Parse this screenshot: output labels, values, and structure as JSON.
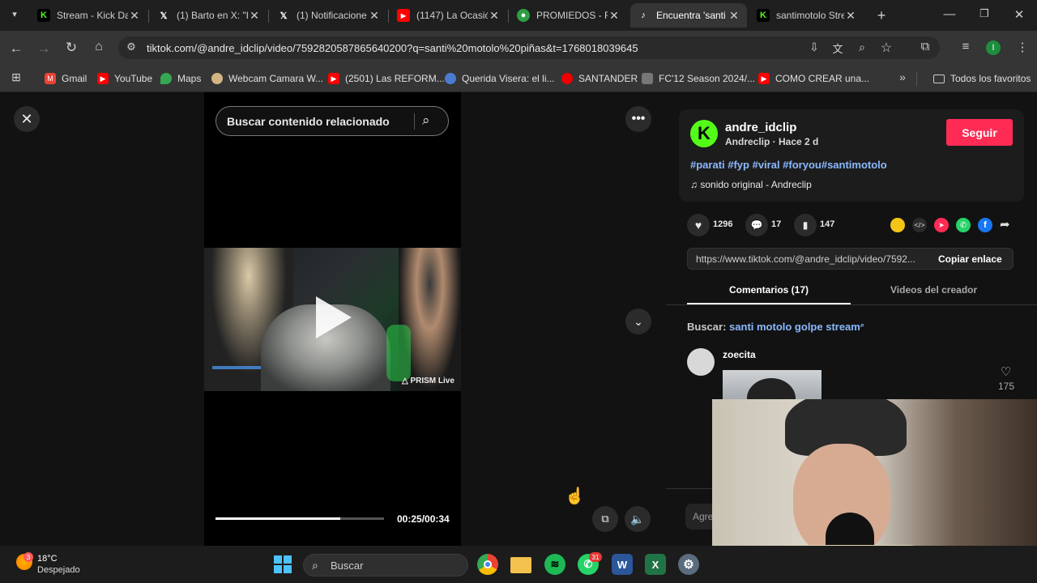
{
  "browser": {
    "tabs": [
      {
        "label": "Stream - Kick Da",
        "icon": "kick-icon",
        "color": "#53fc18"
      },
      {
        "label": "(1) Barto en X: \"I",
        "icon": "x-icon",
        "color": "#ffffff"
      },
      {
        "label": "(1) Notificacione",
        "icon": "x-icon",
        "color": "#ffffff"
      },
      {
        "label": "(1147) La Ocasió",
        "icon": "youtube-icon",
        "color": "#ff0000"
      },
      {
        "label": "PROMIEDOS - F",
        "icon": "promiedos-icon",
        "color": "#2ea043"
      },
      {
        "label": "Encuentra 'santi",
        "icon": "tiktok-icon",
        "color": "#ffffff",
        "active": true
      },
      {
        "label": "santimotolo Stre",
        "icon": "kick-icon",
        "color": "#53fc18"
      }
    ],
    "new_tab": "+",
    "url": "tiktok.com/@andre_idclip/video/7592820587865640200?q=santi%20motolo%20piñas&t=1768018039645",
    "profile_initial": "I",
    "bookmarks": [
      {
        "label": "Gmail",
        "color": "#ea4335",
        "icon": "gmail-icon"
      },
      {
        "label": "YouTube",
        "color": "#ff0000",
        "icon": "youtube-icon"
      },
      {
        "label": "Maps",
        "color": "#34a853",
        "icon": "maps-icon"
      },
      {
        "label": "Webcam Camara W...",
        "color": "#d4b483",
        "icon": "webcam-icon"
      },
      {
        "label": "(2501) Las REFORM...",
        "color": "#ff0000",
        "icon": "youtube-icon"
      },
      {
        "label": "Querida Visera: el li...",
        "color": "#4a7bd0",
        "icon": "site-icon"
      },
      {
        "label": "SANTANDER",
        "color": "#ec0000",
        "icon": "santander-icon"
      },
      {
        "label": "FC'12 Season 2024/...",
        "color": "#999999",
        "icon": "site-icon"
      },
      {
        "label": "COMO CREAR una...",
        "color": "#ff0000",
        "icon": "youtube-icon"
      }
    ],
    "all_bookmarks": "Todos los favoritos"
  },
  "player": {
    "search_placeholder": "Buscar contenido relacionado",
    "watermark": "PRISM Live",
    "time": "00:25/00:34",
    "progress": 0.74
  },
  "video_info": {
    "username": "andre_idclip",
    "display_line": "Andreclip · Hace 2 d",
    "follow_label": "Seguir",
    "hashtags": "#parati #fyp #viral #foryou#santimotolo",
    "sound": "sonido original - Andreclip",
    "likes": "1296",
    "comments": "17",
    "saves": "147",
    "share_link": "https://www.tiktok.com/@andre_idclip/video/7592...",
    "copy_label": "Copiar enlace",
    "tab_comments": "Comentarios (17)",
    "tab_creator": "Videos del creador",
    "search_prefix": "Buscar:",
    "search_term": "santi motolo golpe stream",
    "comment_user": "zoecita",
    "comment_likes": "175",
    "add_comment_placeholder": "Agre"
  },
  "taskbar": {
    "temp": "18°C",
    "weather": "Despejado",
    "weather_badge": "3",
    "search_label": "Buscar",
    "whatsapp_badge": "31"
  },
  "colors": {
    "accent_red": "#fe2c55",
    "link_blue": "#8bb9fe",
    "brand_green": "#53fc18"
  }
}
